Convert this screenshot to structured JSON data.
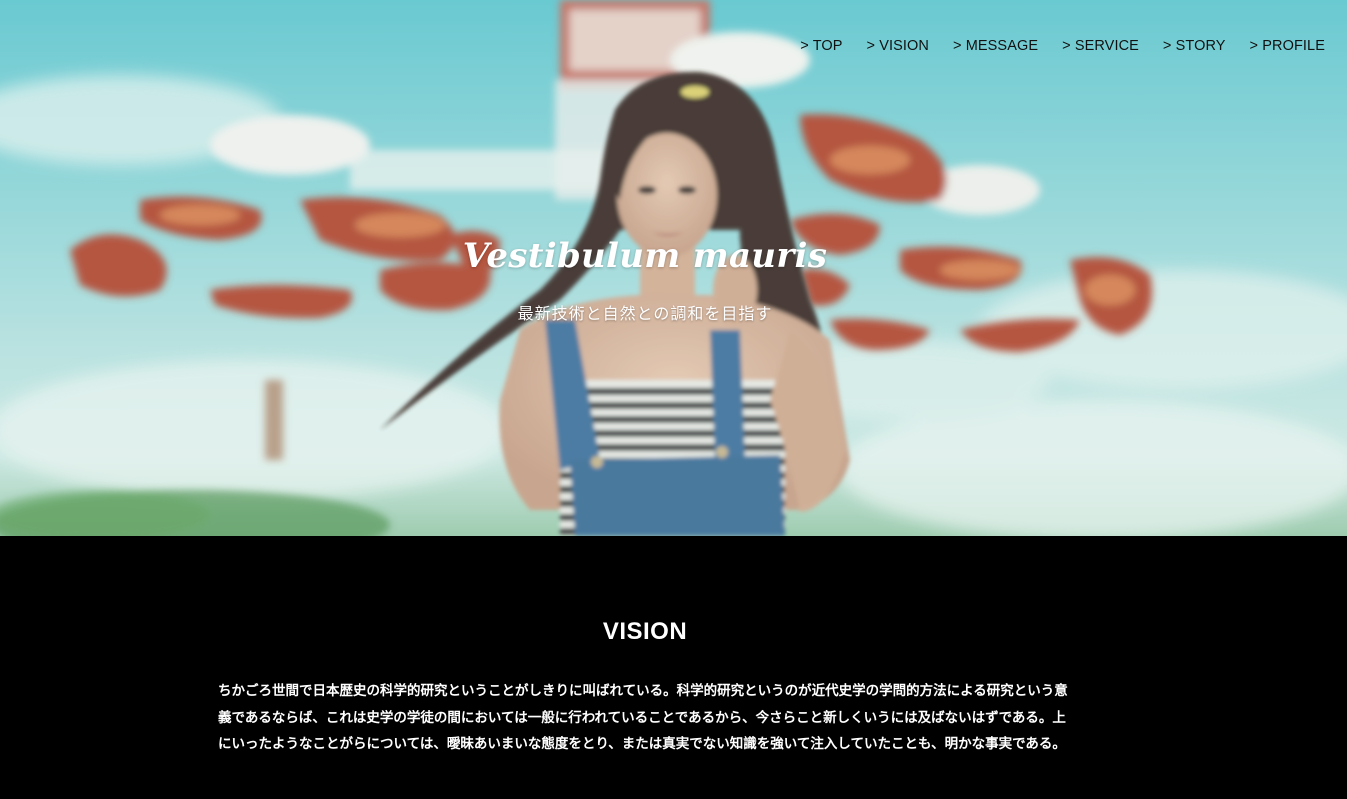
{
  "nav": {
    "items": [
      {
        "label": "> TOP"
      },
      {
        "label": "> VISION"
      },
      {
        "label": "> MESSAGE"
      },
      {
        "label": "> SERVICE"
      },
      {
        "label": "> STORY"
      },
      {
        "label": "> PROFILE"
      }
    ]
  },
  "hero": {
    "title": "Vestibulum mauris",
    "subtitle": "最新技術と自然との調和を目指す",
    "image": "hero-photo-woman-carnival-ride"
  },
  "vision": {
    "heading": "VISION",
    "body": "ちかごろ世間で日本歴史の科学的研究ということがしきりに叫ばれている。科学的研究というのが近代史学の学問的方法による研究という意義であるならば、これは史学の学徒の間においては一般に行われていることであるから、今さらこと新しくいうには及ばないはずである。上にいったようなことがらについては、曖昧あいまいな態度をとり、または真実でない知識を強いて注入していたことも、明かな事実である。"
  },
  "colors": {
    "sky": "#7fd0d6",
    "section_bg": "#000000",
    "text_light": "#ffffff",
    "nav_text": "#111111"
  }
}
